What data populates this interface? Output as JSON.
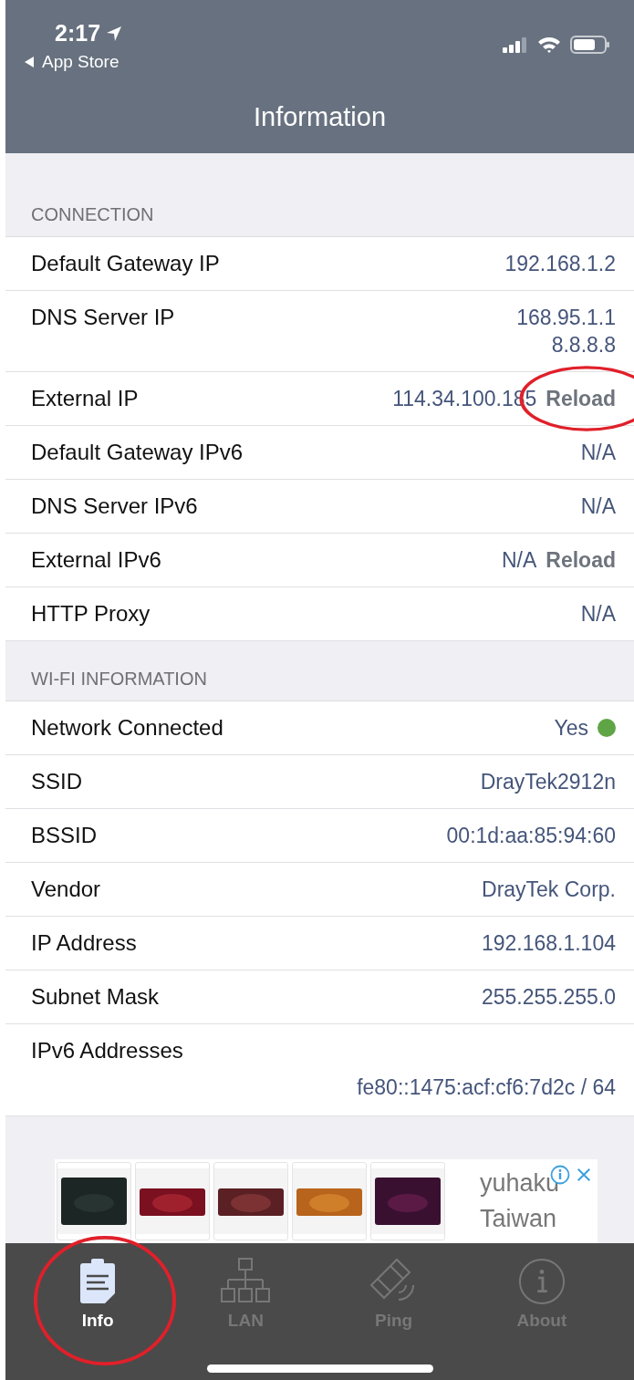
{
  "status_bar": {
    "time": "2:17",
    "back": "App Store"
  },
  "nav": {
    "title": "Information"
  },
  "sections": [
    {
      "title": "CONNECTION",
      "rows": [
        {
          "kind": "inline",
          "label": "Default Gateway IP",
          "values": [
            "192.168.1.2"
          ]
        },
        {
          "kind": "inline",
          "label": "DNS Server IP",
          "values": [
            "168.95.1.1",
            "8.8.8.8"
          ]
        },
        {
          "kind": "inline",
          "label": "External IP",
          "values": [
            "114.34.100.185"
          ],
          "action": "Reload",
          "circled": true
        },
        {
          "kind": "inline",
          "label": "Default Gateway IPv6",
          "values": [
            "N/A"
          ]
        },
        {
          "kind": "inline",
          "label": "DNS Server IPv6",
          "values": [
            "N/A"
          ]
        },
        {
          "kind": "inline",
          "label": "External IPv6",
          "values": [
            "N/A"
          ],
          "action": "Reload",
          "circled": false
        },
        {
          "kind": "inline",
          "label": "HTTP Proxy",
          "values": [
            "N/A"
          ]
        }
      ]
    },
    {
      "title": "WI-FI INFORMATION",
      "rows": [
        {
          "kind": "inline",
          "label": "Network Connected",
          "values": [
            "Yes"
          ],
          "color": "#5fa545"
        },
        {
          "kind": "inline",
          "label": "SSID",
          "values": [
            "DrayTek2912n"
          ]
        },
        {
          "kind": "inline",
          "label": "BSSID",
          "values": [
            "00:1d:aa:85:94:60"
          ]
        },
        {
          "kind": "inline",
          "label": "Vendor",
          "values": [
            "DrayTek Corp."
          ]
        },
        {
          "kind": "inline",
          "label": "IP Address",
          "values": [
            "192.168.1.104"
          ]
        },
        {
          "kind": "inline",
          "label": "Subnet Mask",
          "values": [
            "255.255.255.0"
          ]
        },
        {
          "kind": "stacked",
          "label": "IPv6 Addresses",
          "values": [
            "fe80::1475:acf:cf6:7d2c / 64"
          ]
        }
      ]
    }
  ],
  "ad": {
    "brand": "yuhaku",
    "region": "Taiwan"
  },
  "tabs": [
    {
      "kind": "info",
      "label": "Info",
      "selected": true,
      "circled": true
    },
    {
      "kind": "lan",
      "label": "LAN",
      "selected": false,
      "circled": false
    },
    {
      "kind": "ping",
      "label": "Ping",
      "selected": false,
      "circled": false
    },
    {
      "kind": "about",
      "label": "About",
      "selected": false,
      "circled": false
    }
  ]
}
